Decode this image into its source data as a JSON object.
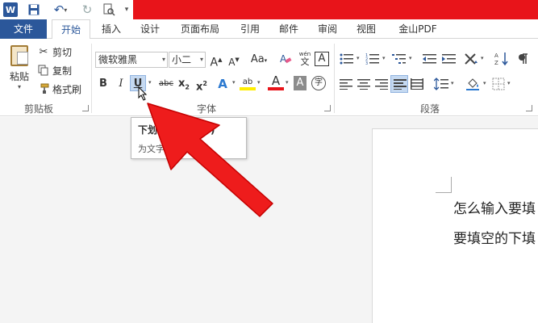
{
  "qat": {
    "app_icon": "word-icon",
    "app_letter": "W",
    "save_icon": "save-icon",
    "undo_glyph": "↶",
    "redo_glyph": "↻",
    "dropdown_glyph": "▾",
    "accent": "#e8141a"
  },
  "tabs": {
    "file": "文件",
    "home": "开始",
    "insert": "插入",
    "design": "设计",
    "layout": "页面布局",
    "references": "引用",
    "mailings": "邮件",
    "review": "审阅",
    "view": "视图",
    "wps_pdf": "金山PDF"
  },
  "clipboard": {
    "paste": "粘贴",
    "cut": "剪切",
    "copy": "复制",
    "format_painter": "格式刷",
    "group_label": "剪贴板"
  },
  "font": {
    "name_value": "微软雅黑",
    "size_value": "小二",
    "grow": "A",
    "shrink": "A",
    "change_case": "Aa",
    "pinyin_top": "wén",
    "pinyin_char": "文",
    "border_char": "A",
    "bold": "B",
    "italic": "I",
    "underline": "U",
    "strikethrough": "abc",
    "subscript": "x",
    "subscript_mark": "2",
    "superscript": "x",
    "superscript_mark": "2",
    "text_effects": "A",
    "highlight": "ab",
    "font_color": "A",
    "shading_char": "A",
    "enclose_char": "字",
    "group_label": "字体"
  },
  "paragraph": {
    "group_label": "段落"
  },
  "tooltip": {
    "title": "下划线 (Ctrl+U)",
    "description": "为文字添加下划线。"
  },
  "document": {
    "line1": "怎么输入要填",
    "line2": "要填空的下填"
  }
}
